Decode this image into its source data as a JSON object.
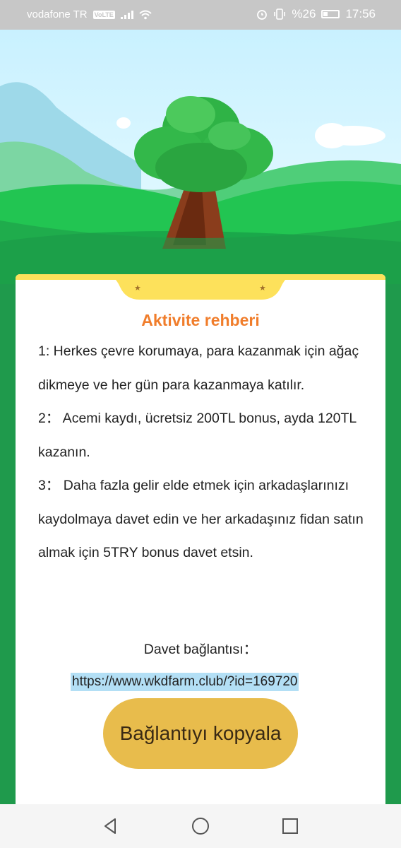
{
  "status_bar": {
    "carrier": "vodafone TR",
    "volte": "VoLTE",
    "battery": "%26",
    "time": "17:56"
  },
  "content": {
    "title": "Aktivite rehberi",
    "paragraphs": [
      "1: Herkes çevre korumaya, para kazanmak için ağaç dikmeye ve her gün para kazanmaya katılır.",
      "2： Acemi kaydı, ücretsiz 200TL bonus, ayda 120TL kazanın.",
      "3： Daha fazla gelir elde etmek için arkadaşlarınızı kaydolmaya davet edin ve her arkadaşınız fidan satın almak için 5TRY bonus davet etsin."
    ],
    "invite_label": "Davet bağlantısı：",
    "invite_link": "https://www.wkdfarm.club/?id=169720",
    "copy_button": "Bağlantıyı kopyala"
  },
  "icons": {
    "alarm": "alarm-icon",
    "vibrate": "vibrate-icon",
    "wifi": "wifi-icon",
    "battery": "battery-icon",
    "back": "back-icon",
    "home": "home-icon",
    "recents": "recents-icon"
  },
  "colors": {
    "title": "#f07d2b",
    "button": "#e8bc4c",
    "card_frame": "#1f9a4c",
    "link_highlight": "#b3dff5"
  }
}
